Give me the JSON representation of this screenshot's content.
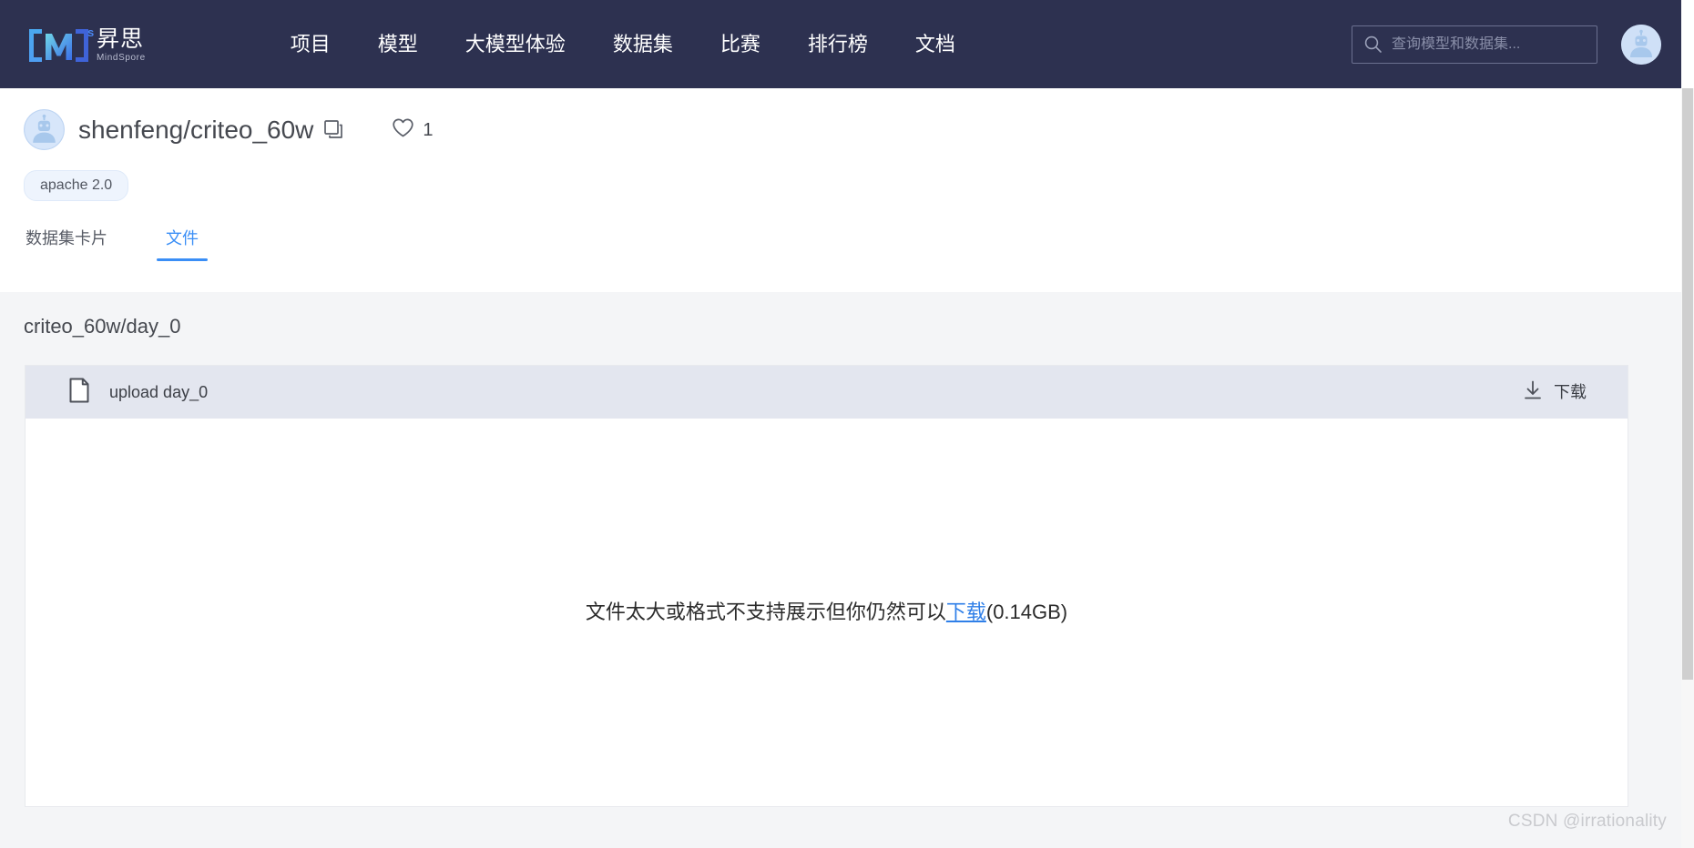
{
  "header": {
    "logo": {
      "bracket_left": "[",
      "letter": "M",
      "bracket_right": "]",
      "superscript": "S",
      "name_cn": "昇思",
      "name_en": "MindSpore"
    },
    "nav": [
      {
        "label": "项目"
      },
      {
        "label": "模型"
      },
      {
        "label": "大模型体验"
      },
      {
        "label": "数据集"
      },
      {
        "label": "比赛"
      },
      {
        "label": "排行榜"
      },
      {
        "label": "文档"
      }
    ],
    "search": {
      "placeholder": "查询模型和数据集...",
      "value": "",
      "icon": "search-icon"
    },
    "user_avatar_icon": "robot-avatar-icon",
    "background_color": "#2d3150"
  },
  "repo": {
    "owner_avatar_icon": "robot-avatar-icon",
    "title": "shenfeng/criteo_60w",
    "copy_icon": "copy-icon",
    "like_icon": "heart-icon",
    "like_count": "1",
    "license": "apache 2.0"
  },
  "tabs": [
    {
      "label": "数据集卡片",
      "active": false
    },
    {
      "label": "文件",
      "active": true
    }
  ],
  "content": {
    "breadcrumb": "criteo_60w/day_0",
    "file_row": {
      "file_icon": "file-document-icon",
      "name": "upload day_0",
      "download_icon": "download-icon",
      "download_label": "下载"
    },
    "preview": {
      "message_prefix": "文件太大或格式不支持展示但你仍然可以",
      "link_label": "下载",
      "message_suffix": "(0.14GB)"
    }
  },
  "watermark": "CSDN @irrationality",
  "colors": {
    "nav_background": "#2d3150",
    "accent_blue": "#3a8ef6",
    "link_blue": "#2f7fe8",
    "page_background": "#f4f5f7",
    "file_row_background": "#e3e6ef",
    "badge_background": "#eef4fd"
  }
}
